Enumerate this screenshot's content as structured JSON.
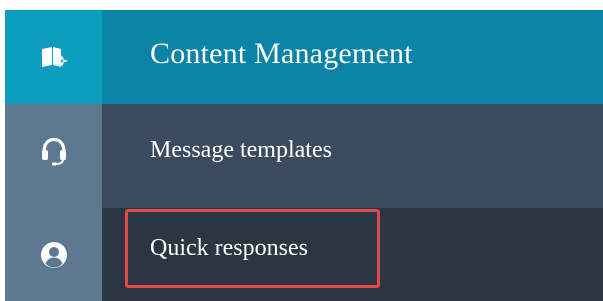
{
  "rail": {
    "items": [
      {
        "icon": "content-library-icon",
        "active": true
      },
      {
        "icon": "headset-icon",
        "active": false
      },
      {
        "icon": "user-circle-icon",
        "active": false
      }
    ]
  },
  "panel": {
    "title": "Content Management",
    "items": [
      {
        "label": "Message templates"
      },
      {
        "label": "Quick responses"
      }
    ]
  },
  "colors": {
    "rail": "#5e7890",
    "rail_active": "#0f9dbd",
    "header": "#0a83a6",
    "item_templates": "#3b4a5e",
    "item_quick": "#2c3642",
    "highlight": "#e2474a"
  }
}
